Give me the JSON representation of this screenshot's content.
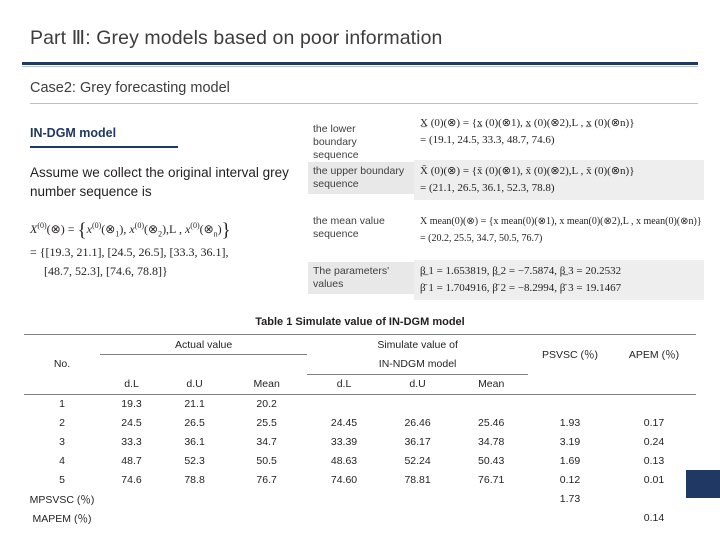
{
  "slide": {
    "title": "Part Ⅲ: Grey models based on poor information",
    "case_heading": "Case2: Grey forecasting model",
    "model_label": "IN-DGM model",
    "assume_text": "Assume we collect the original interval grey number sequence is",
    "accent_color": "#1f3864"
  },
  "callouts": [
    {
      "label": "the lower boundary sequence"
    },
    {
      "label": "the upper boundary sequence"
    },
    {
      "label": "the mean value sequence"
    },
    {
      "label": "The parameters' values"
    }
  ],
  "left_formula": {
    "line1_a": "X",
    "line1_sup": "(0)",
    "line1_b": "(⊗) =",
    "line1_set": "{x",
    "line1_set_sup": "(0)",
    "line1_set_rest": "(⊗",
    "line1_sub1": "1",
    "line1_rest2": "), x",
    "line1_sup2": "(0)",
    "line1_rest3": "(⊗",
    "line1_sub2": "2",
    "line1_rest4": "),L , x",
    "line1_sup3": "(0)",
    "line1_rest5": "(⊗",
    "line1_subn": "n",
    "line1_rest6": ")}",
    "line2": "= {[19.3, 21.1], [24.5, 26.5], [33.3, 36.1],",
    "line3": "[48.7, 52.3], [74.6, 78.8]}"
  },
  "right_panels": {
    "lower": {
      "line1": "X̲ (0)(⊗) = {x̲ (0)(⊗1), x̲ (0)(⊗2),L , x̲ (0)(⊗n)}",
      "line2": "= (19.1, 24.5, 33.3, 48.7, 74.6)"
    },
    "upper": {
      "line1": "X̄ (0)(⊗) = {x̄ (0)(⊗1), x̄ (0)(⊗2),L , x̄ (0)(⊗n)}",
      "line2": "= (21.1, 26.5, 36.1, 52.3, 78.8)"
    },
    "mean": {
      "line1": "X mean(0)(⊗) = {x mean(0)(⊗1), x mean(0)(⊗2),L , x mean(0)(⊗n)}",
      "line2": "= (20.2, 25.5, 34.7, 50.5, 76.7)"
    },
    "params": {
      "line1": "β̲ 1 = 1.653819, β̲ 2 = −7.5874, β̲ 3 = 20.2532",
      "line2": "β̄ 1 = 1.704916, β̄ 2 = −8.2994, β̄ 3 = 19.1467"
    }
  },
  "table": {
    "caption": "Table 1 Simulate value of IN-DGM model",
    "group_headers": {
      "actual": "Actual value",
      "simulate_line1": "Simulate value of",
      "simulate_line2": "IN-NDGM model"
    },
    "columns": {
      "no": "No.",
      "actual_dl": "d.L",
      "actual_du": "d.U",
      "actual_mean": "Mean",
      "sim_dl": "d.L",
      "sim_du": "d.U",
      "sim_mean": "Mean",
      "psvsc": "PSVSC (％)",
      "apem": "APEM (％)"
    },
    "rows": [
      {
        "no": "1",
        "a_dl": "19.3",
        "a_du": "21.1",
        "a_mean": "20.2",
        "s_dl": "",
        "s_du": "",
        "s_mean": "",
        "psvsc": "",
        "apem": ""
      },
      {
        "no": "2",
        "a_dl": "24.5",
        "a_du": "26.5",
        "a_mean": "25.5",
        "s_dl": "24.45",
        "s_du": "26.46",
        "s_mean": "25.46",
        "psvsc": "1.93",
        "apem": "0.17"
      },
      {
        "no": "3",
        "a_dl": "33.3",
        "a_du": "36.1",
        "a_mean": "34.7",
        "s_dl": "33.39",
        "s_du": "36.17",
        "s_mean": "34.78",
        "psvsc": "3.19",
        "apem": "0.24"
      },
      {
        "no": "4",
        "a_dl": "48.7",
        "a_du": "52.3",
        "a_mean": "50.5",
        "s_dl": "48.63",
        "s_du": "52.24",
        "s_mean": "50.43",
        "psvsc": "1.69",
        "apem": "0.13"
      },
      {
        "no": "5",
        "a_dl": "74.6",
        "a_du": "78.8",
        "a_mean": "76.7",
        "s_dl": "74.60",
        "s_du": "78.81",
        "s_mean": "76.71",
        "psvsc": "0.12",
        "apem": "0.01"
      }
    ],
    "footer_rows": [
      {
        "label": "MPSVSC (％)",
        "value": "1.73"
      },
      {
        "label": "MAPEM (％)",
        "value": "0.14"
      }
    ]
  }
}
